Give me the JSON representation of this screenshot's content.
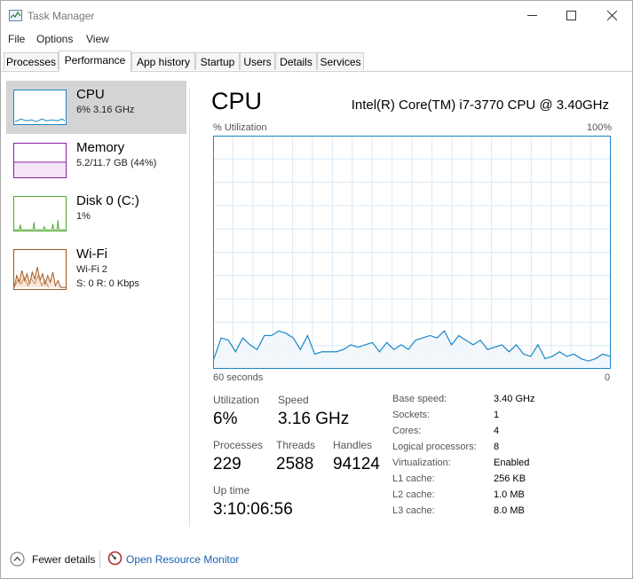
{
  "window": {
    "title": "Task Manager"
  },
  "menu": {
    "items": [
      "File",
      "Options",
      "View"
    ]
  },
  "tabs": [
    "Processes",
    "Performance",
    "App history",
    "Startup",
    "Users",
    "Details",
    "Services"
  ],
  "active_tab": "Performance",
  "sidebar": {
    "items": [
      {
        "name": "CPU",
        "sub1": "6%  3.16 GHz",
        "sub2": ""
      },
      {
        "name": "Memory",
        "sub1": "5.2/11.7 GB (44%)",
        "sub2": ""
      },
      {
        "name": "Disk 0 (C:)",
        "sub1": "1%",
        "sub2": ""
      },
      {
        "name": "Wi-Fi",
        "sub1": "Wi-Fi 2",
        "sub2": "S: 0  R: 0 Kbps"
      }
    ],
    "colors": {
      "cpu": "#1b86c8",
      "memory": "#8b1fa6",
      "disk": "#4ea72e",
      "wifi": "#a3561d"
    }
  },
  "cpu": {
    "title": "CPU",
    "model": "Intel(R) Core(TM) i7-3770 CPU @ 3.40GHz",
    "graph_label_left": "% Utilization",
    "graph_label_right_top": "100%",
    "time_label": "60 seconds",
    "graph_label_right_bottom": "0",
    "utilization_history": [
      4,
      13,
      12,
      7,
      13,
      10,
      8,
      14,
      14,
      16,
      15,
      13,
      8,
      14,
      6,
      7,
      7,
      7,
      8,
      10,
      9,
      10,
      11,
      7,
      11,
      8,
      10,
      8,
      12,
      13,
      14,
      13,
      16,
      10,
      14,
      12,
      10,
      12,
      8,
      9,
      10,
      7,
      10,
      6,
      5,
      10,
      4,
      5,
      7,
      5,
      6,
      4,
      3,
      4,
      6,
      5
    ],
    "stats": {
      "utilization_label": "Utilization",
      "utilization": "6%",
      "speed_label": "Speed",
      "speed": "3.16 GHz",
      "processes_label": "Processes",
      "processes": "229",
      "threads_label": "Threads",
      "threads": "2588",
      "handles_label": "Handles",
      "handles": "94124",
      "uptime_label": "Up time",
      "uptime": "3:10:06:56"
    },
    "specs": [
      {
        "label": "Base speed:",
        "value": "3.40 GHz"
      },
      {
        "label": "Sockets:",
        "value": "1"
      },
      {
        "label": "Cores:",
        "value": "4"
      },
      {
        "label": "Logical processors:",
        "value": "8"
      },
      {
        "label": "Virtualization:",
        "value": "Enabled"
      },
      {
        "label": "L1 cache:",
        "value": "256 KB"
      },
      {
        "label": "L2 cache:",
        "value": "1.0 MB"
      },
      {
        "label": "L3 cache:",
        "value": "8.0 MB"
      }
    ],
    "line_color": "#1b86c8",
    "fill_color": "#f1f6fb",
    "grid_color": "#d9eaf7"
  },
  "footer": {
    "fewer_details": "Fewer details",
    "resource_monitor": "Open Resource Monitor"
  }
}
